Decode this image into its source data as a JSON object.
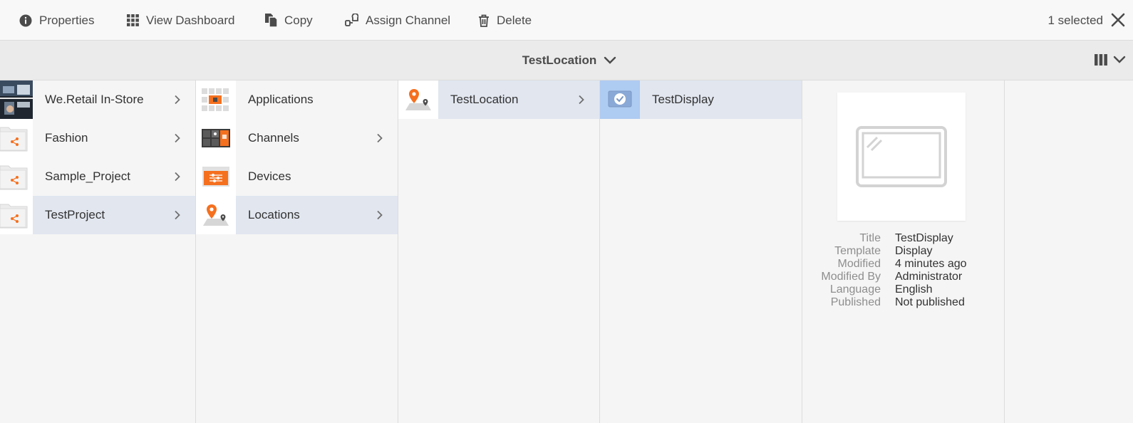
{
  "actionbar": {
    "actions": [
      {
        "label": "Properties",
        "icon": "info-icon"
      },
      {
        "label": "View Dashboard",
        "icon": "grid-icon"
      },
      {
        "label": "Copy",
        "icon": "copy-icon"
      },
      {
        "label": "Assign Channel",
        "icon": "assign-channel-icon"
      },
      {
        "label": "Delete",
        "icon": "trash-icon"
      }
    ],
    "selected_count": "1 selected",
    "close_icon": "close-icon"
  },
  "titlebar": {
    "title": "TestLocation",
    "view_icon": "column-view-icon"
  },
  "columns": [
    {
      "items": [
        {
          "label": "We.Retail In-Store",
          "thumb": "photo-thumbnail",
          "has_children": true
        },
        {
          "label": "Fashion",
          "thumb": "project-folder-icon",
          "has_children": true
        },
        {
          "label": "Sample_Project",
          "thumb": "project-folder-icon",
          "has_children": true
        },
        {
          "label": "TestProject",
          "thumb": "project-folder-icon",
          "has_children": true,
          "active": true
        }
      ]
    },
    {
      "items": [
        {
          "label": "Applications",
          "thumb": "applications-icon",
          "has_children": false
        },
        {
          "label": "Channels",
          "thumb": "channels-icon",
          "has_children": true
        },
        {
          "label": "Devices",
          "thumb": "devices-icon",
          "has_children": false
        },
        {
          "label": "Locations",
          "thumb": "location-pin-icon",
          "has_children": true,
          "active": true
        }
      ]
    },
    {
      "items": [
        {
          "label": "TestLocation",
          "thumb": "location-pin-icon",
          "has_children": true,
          "active": true
        }
      ]
    },
    {
      "items": [
        {
          "label": "TestDisplay",
          "thumb": "display-checked-icon",
          "has_children": false,
          "selected": true
        }
      ]
    }
  ],
  "preview": {
    "icon": "display-placeholder-icon",
    "meta": [
      {
        "key": "Title",
        "value": "TestDisplay"
      },
      {
        "key": "Template",
        "value": "Display"
      },
      {
        "key": "Modified",
        "value": "4 minutes ago"
      },
      {
        "key": "Modified By",
        "value": "Administrator"
      },
      {
        "key": "Language",
        "value": "English"
      },
      {
        "key": "Published",
        "value": "Not published"
      }
    ]
  },
  "colors": {
    "accent_orange": "#f5701e",
    "selection_blue": "#aecbf2",
    "row_active": "#e1e6ef"
  }
}
